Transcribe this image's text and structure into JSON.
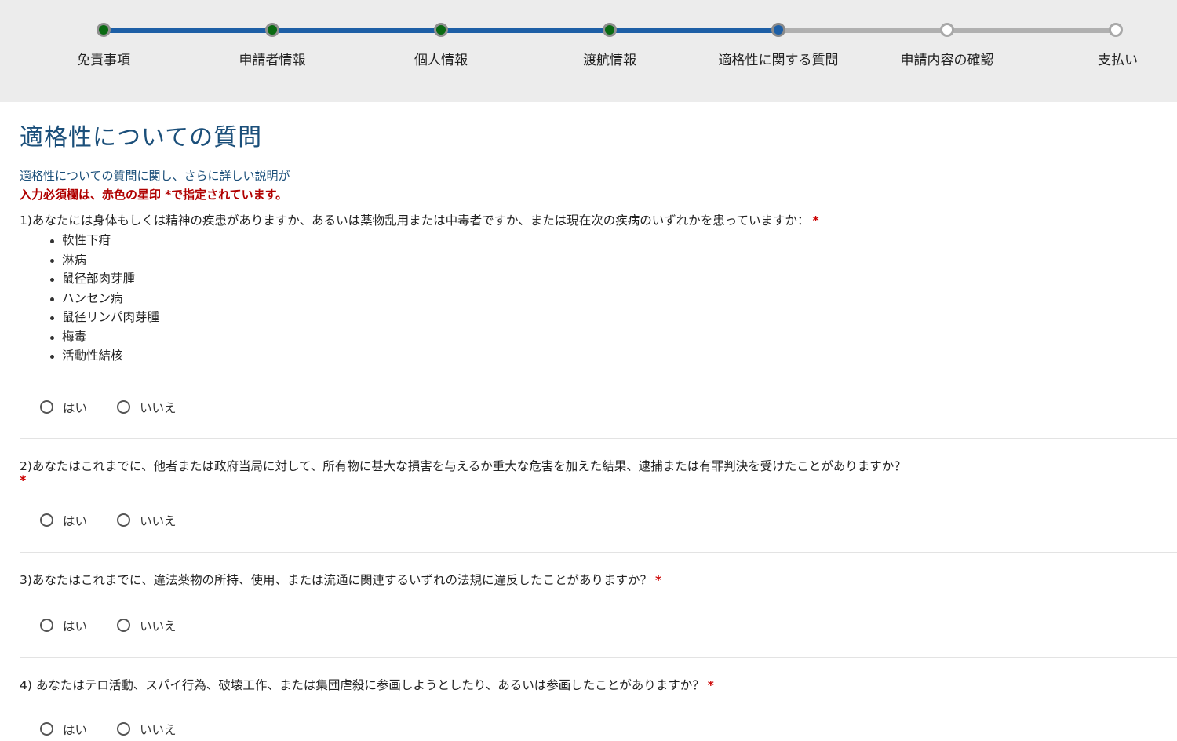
{
  "stepper": {
    "steps": [
      {
        "label": "免責事項",
        "status": "done"
      },
      {
        "label": "申請者情報",
        "status": "done"
      },
      {
        "label": "個人情報",
        "status": "done"
      },
      {
        "label": "渡航情報",
        "status": "done"
      },
      {
        "label": "適格性に関する質問",
        "status": "current"
      },
      {
        "label": "申請内容の確認",
        "status": "todo"
      },
      {
        "label": "支払い",
        "status": "todo"
      }
    ],
    "colors": {
      "done_line": "#1d5fa6",
      "todo_line": "#b0b0b0",
      "done_dot": "#0a6a12",
      "current_dot": "#1d5fa6"
    }
  },
  "page": {
    "title": "適格性についての質問",
    "help_note": "適格性についての質問に関し、さらに詳しい説明が",
    "required_note": "入力必須欄は、赤色の星印 *で指定されています。"
  },
  "required_marker": "*",
  "options": {
    "yes": "はい",
    "no": "いいえ"
  },
  "questions": [
    {
      "text": "1)あなたには身体もしくは精神の疾患がありますか、あるいは薬物乱用または中毒者ですか、または現在次の疾病のいずれかを患っていますか：",
      "list": [
        "軟性下疳",
        "淋病",
        "鼠径部肉芽腫",
        "ハンセン病",
        "鼠径リンパ肉芽腫",
        "梅毒",
        "活動性結核"
      ]
    },
    {
      "text": "2)あなたはこれまでに、他者または政府当局に対して、所有物に甚大な損害を与えるか重大な危害を加えた結果、逮捕または有罪判決を受けたことがありますか？"
    },
    {
      "text": "3)あなたはこれまでに、違法薬物の所持、使用、または流通に関連するいずれの法規に違反したことがありますか？"
    },
    {
      "text": "4) あなたはテロ活動、スパイ行為、破壊工作、または集団虐殺に参画しようとしたり、あるいは参画したことがありますか？"
    }
  ]
}
